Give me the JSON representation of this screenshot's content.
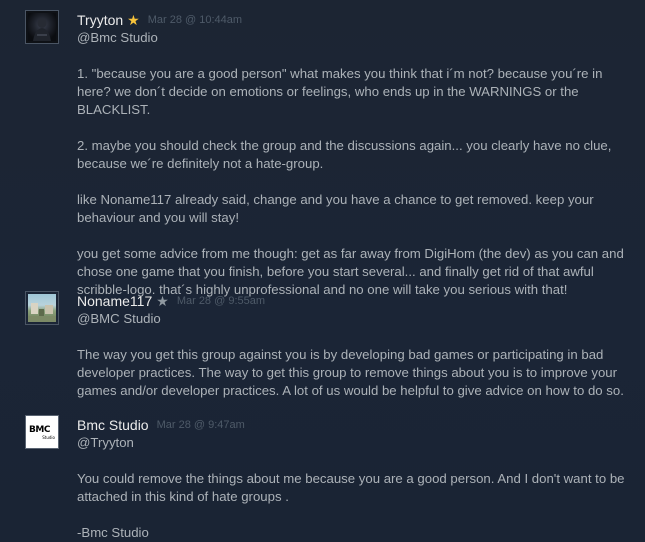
{
  "comments": [
    {
      "author": "Tryyton",
      "badge": "★",
      "badge_color": "#f7c33b",
      "timestamp": "Mar 28 @ 10:44am",
      "avatar_icon": "dark-figure-avatar",
      "paragraphs": [
        "@Bmc Studio",
        "1. \"because you are a good person\" what makes you think that i´m not? because you´re in here? we don´t decide on emotions or feelings, who ends up in the WARNINGS or the BLACKLIST.",
        "2. maybe you should check the group and the discussions again... you clearly have no clue, because we´re definitely not a hate-group.",
        "like Noname117 already said, change and you have a chance to get removed. keep your behaviour and you will stay!",
        "you get some advice from me though: get as far away from DigiHom (the dev) as you can and chose one game that you finish, before you start several... and finally get rid of that awful scribble-logo. that´s highly unprofessional and no one will take you serious with that!"
      ]
    },
    {
      "author": "Noname117",
      "badge": "★",
      "badge_color": "#8f98a0",
      "timestamp": "Mar 28 @ 9:55am",
      "avatar_icon": "landscape-avatar",
      "paragraphs": [
        "@BMC Studio",
        "The way you get this group against you is by developing bad games or participating in bad developer practices. The way to get this group to remove things about you is to improve your games and/or developer practices. A lot of us would be helpful to give advice on how to do so."
      ]
    },
    {
      "author": "Bmc Studio",
      "badge": "",
      "timestamp": "Mar 28 @ 9:47am",
      "avatar_icon": "bmc-logo-avatar",
      "avatar_logo_main": "BMC",
      "avatar_logo_sub": "Studio",
      "paragraphs": [
        "@Tryyton",
        "You could remove the things about me because you are a good person. And I don't want to be attached in this kind of hate groups .",
        "-Bmc Studio"
      ]
    }
  ]
}
